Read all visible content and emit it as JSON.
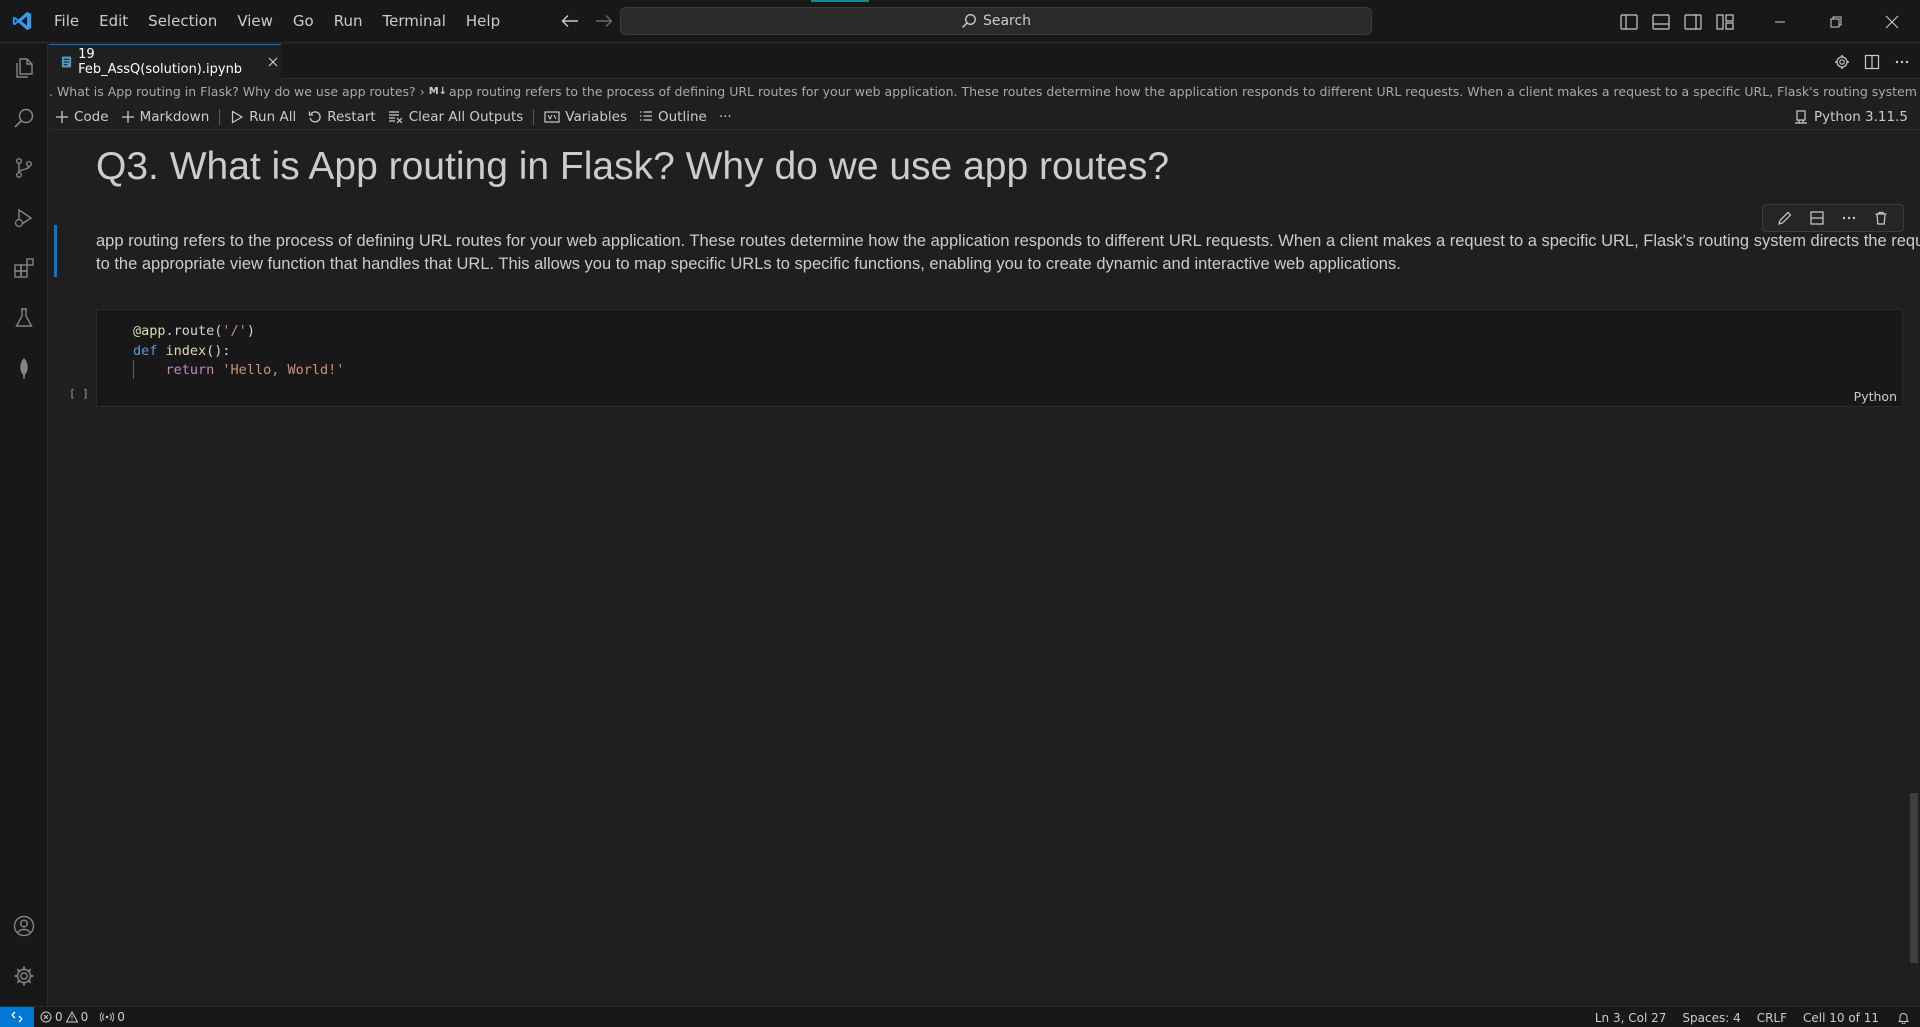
{
  "menu": [
    "File",
    "Edit",
    "Selection",
    "View",
    "Go",
    "Run",
    "Terminal",
    "Help"
  ],
  "search": {
    "label": "Search"
  },
  "tab": {
    "title": "19 Feb_AssQ(solution).ipynb"
  },
  "breadcrumb": {
    "heading": ". What is App routing in Flask? Why do we use app routes?",
    "md_marker": "M↓",
    "paragraph": "app routing refers to the process of defining URL routes for your web application. These routes determine how the application responds to different URL requests. When a client makes a request to a specific URL, Flask's routing system directs the r..."
  },
  "toolbar": {
    "code": "Code",
    "markdown": "Markdown",
    "run_all": "Run All",
    "restart": "Restart",
    "clear_outputs": "Clear All Outputs",
    "variables": "Variables",
    "outline": "Outline",
    "more": "···",
    "kernel": "Python 3.11.5"
  },
  "cells": {
    "heading": "Q3. What is App routing in Flask? Why do we use app routes?",
    "paragraph": "app routing refers to the process of defining URL routes for your web application. These routes determine how the application responds to different URL requests. When a client makes a request to a specific URL, Flask's routing system directs the request to the appropriate view function that handles that URL. This allows you to map specific URLs to specific functions, enabling you to create dynamic and interactive web applications.",
    "code": {
      "line1_dec": "@app",
      "line1_rest": ".route(",
      "line1_str": "'/'",
      "line1_end": ")",
      "line2_kw": "def",
      "line2_fn": " index",
      "line2_rest": "():",
      "line3_indent": "    ",
      "line3_kw": "return",
      "line3_str": " 'Hello, World!'"
    },
    "language": "Python",
    "exec_count": "[ ]"
  },
  "status": {
    "errors": "0",
    "warnings": "0",
    "ports": "0",
    "position": "Ln 3, Col 27",
    "spaces": "Spaces: 4",
    "eol": "CRLF",
    "cell": "Cell 10 of 11"
  },
  "colors": {
    "accent": "#0078d4",
    "background": "#1f1f1f",
    "chrome": "#181818"
  }
}
